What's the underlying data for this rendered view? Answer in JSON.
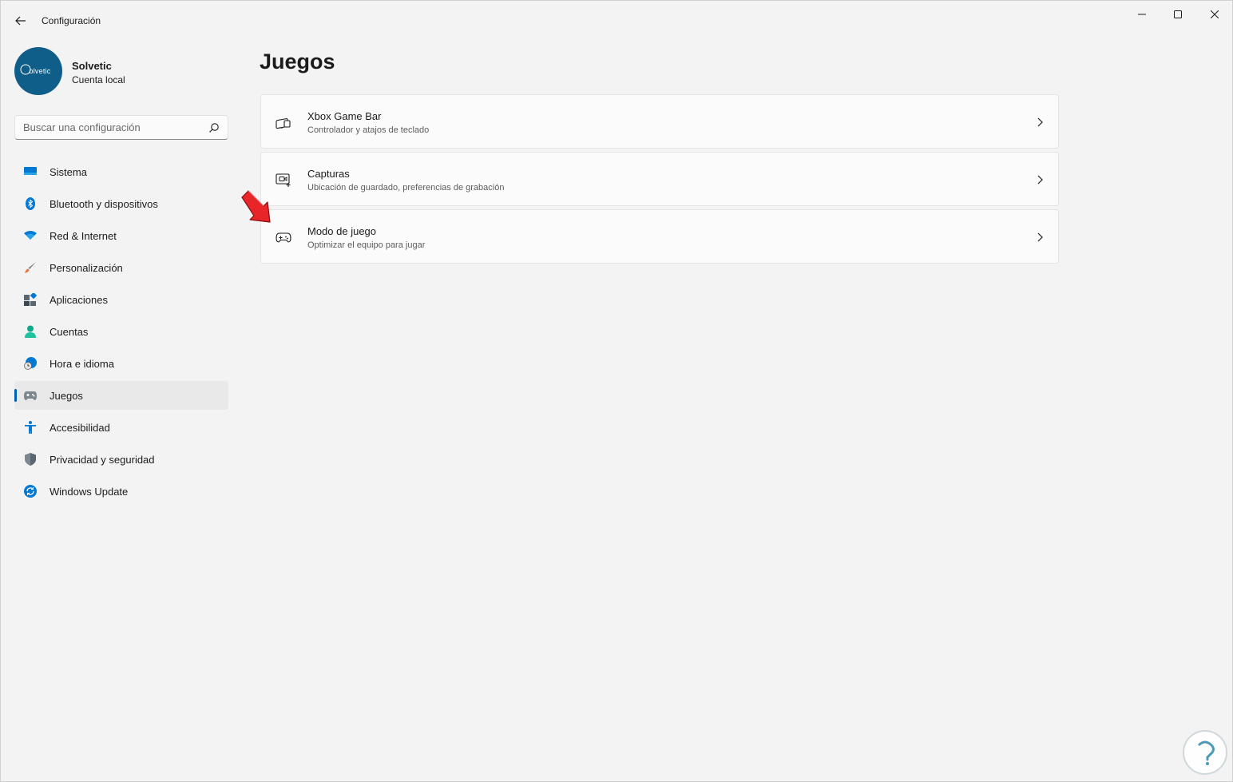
{
  "window": {
    "app_title": "Configuración"
  },
  "profile": {
    "avatar_text": "olvetic",
    "name": "Solvetic",
    "account_type": "Cuenta local"
  },
  "search": {
    "placeholder": "Buscar una configuración"
  },
  "sidebar": {
    "items": [
      {
        "label": "Sistema",
        "icon": "monitor-icon"
      },
      {
        "label": "Bluetooth y dispositivos",
        "icon": "bluetooth-icon"
      },
      {
        "label": "Red & Internet",
        "icon": "wifi-icon"
      },
      {
        "label": "Personalización",
        "icon": "brush-icon"
      },
      {
        "label": "Aplicaciones",
        "icon": "apps-icon"
      },
      {
        "label": "Cuentas",
        "icon": "person-icon"
      },
      {
        "label": "Hora e idioma",
        "icon": "clock-globe-icon"
      },
      {
        "label": "Juegos",
        "icon": "gamepad-icon",
        "active": true
      },
      {
        "label": "Accesibilidad",
        "icon": "accessibility-icon"
      },
      {
        "label": "Privacidad y seguridad",
        "icon": "shield-icon"
      },
      {
        "label": "Windows Update",
        "icon": "update-icon"
      }
    ]
  },
  "main": {
    "title": "Juegos",
    "cards": [
      {
        "title": "Xbox Game Bar",
        "subtitle": "Controlador y atajos de teclado",
        "icon": "game-bar-icon"
      },
      {
        "title": "Capturas",
        "subtitle": "Ubicación de guardado, preferencias de grabación",
        "icon": "capture-icon"
      },
      {
        "title": "Modo de juego",
        "subtitle": "Optimizar el equipo para jugar",
        "icon": "gamepad-icon"
      }
    ]
  },
  "colors": {
    "accent": "#005fb8",
    "annotation_arrow": "#e8262a"
  }
}
